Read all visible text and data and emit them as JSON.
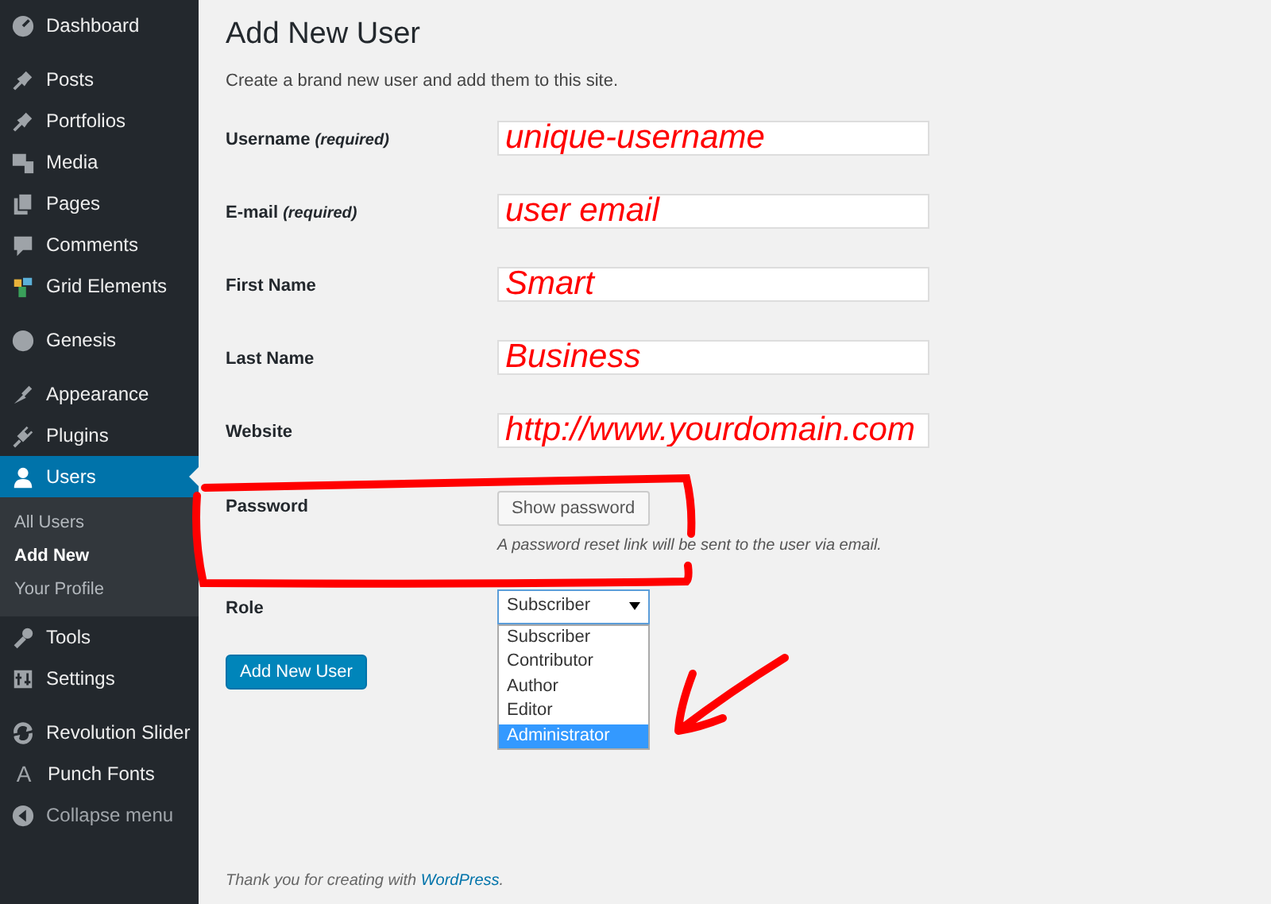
{
  "sidebar": {
    "groups": [
      [
        {
          "label": "Dashboard",
          "selected": false
        }
      ],
      [
        {
          "label": "Posts",
          "selected": false
        },
        {
          "label": "Portfolios",
          "selected": false
        },
        {
          "label": "Media",
          "selected": false
        },
        {
          "label": "Pages",
          "selected": false
        },
        {
          "label": "Comments",
          "selected": false
        },
        {
          "label": "Grid Elements",
          "selected": false
        }
      ],
      [
        {
          "label": "Genesis",
          "selected": false
        }
      ],
      [
        {
          "label": "Appearance",
          "selected": false
        },
        {
          "label": "Plugins",
          "selected": false
        },
        {
          "label": "Users",
          "selected": true,
          "children": [
            {
              "label": "All Users",
              "selected": false
            },
            {
              "label": "Add New",
              "selected": true
            },
            {
              "label": "Your Profile",
              "selected": false
            }
          ]
        },
        {
          "label": "Tools",
          "selected": false
        },
        {
          "label": "Settings",
          "selected": false
        }
      ],
      [
        {
          "label": "Revolution Slider",
          "selected": false
        },
        {
          "label": "Punch Fonts",
          "selected": false,
          "icon_text": "A"
        },
        {
          "label": "Collapse menu",
          "selected": false,
          "kind": "collapse"
        }
      ]
    ]
  },
  "page": {
    "title": "Add New User",
    "description": "Create a brand new user and add them to this site.",
    "fields": [
      {
        "kind": "text",
        "label": "Username",
        "note": "(required)",
        "value": "unique-username"
      },
      {
        "kind": "text",
        "label": "E-mail",
        "note": "(required)",
        "value": "user email"
      },
      {
        "kind": "text",
        "label": "First Name",
        "value": "Smart"
      },
      {
        "kind": "text",
        "label": "Last Name",
        "value": "Business"
      },
      {
        "kind": "text",
        "label": "Website",
        "value": "http://www.yourdomain.com"
      },
      {
        "kind": "button",
        "label": "Password",
        "button": "Show password",
        "hint": "A password reset link will be sent to the user via email."
      },
      {
        "kind": "select",
        "label": "Role",
        "value": "Subscriber",
        "options": [
          {
            "label": "Subscriber",
            "highlighted": false
          },
          {
            "label": "Contributor",
            "highlighted": false
          },
          {
            "label": "Author",
            "highlighted": false
          },
          {
            "label": "Editor",
            "highlighted": false
          },
          {
            "label": "Administrator",
            "highlighted": true
          }
        ]
      }
    ],
    "submit": "Add New User"
  },
  "footer": {
    "text": "Thank you for creating with ",
    "link": "WordPress",
    "end": "."
  }
}
